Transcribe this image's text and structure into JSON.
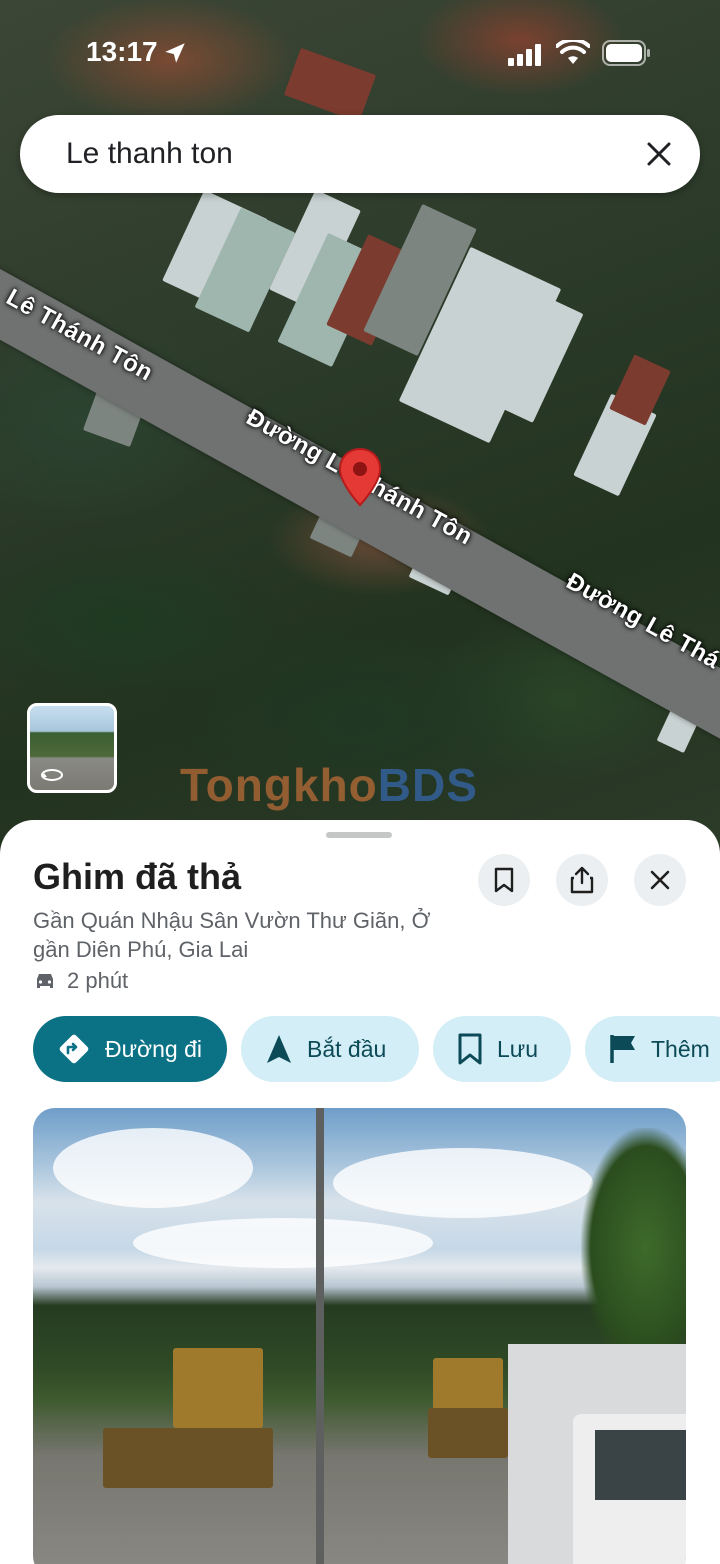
{
  "status_bar": {
    "time": "13:17"
  },
  "search": {
    "query": "Le thanh ton"
  },
  "map": {
    "road_labels": [
      "Lê Thánh Tôn",
      "Đường Lê Thánh Tôn",
      "Đường Lê Thá"
    ],
    "watermark": {
      "part1": "Tongkho",
      "part2": "BDS"
    }
  },
  "place": {
    "title": "Ghim đã thả",
    "address": "Gần Quán Nhậu Sân Vườn Thư Giãn, Ở gần Diên Phú, Gia Lai",
    "drive_time": "2 phút"
  },
  "actions": {
    "directions": "Đường đi",
    "start": "Bắt đầu",
    "save": "Lưu",
    "more": "Thêm"
  },
  "colors": {
    "primary": "#0b7285",
    "chip_bg": "#d3eef6",
    "pin": "#e53935"
  }
}
